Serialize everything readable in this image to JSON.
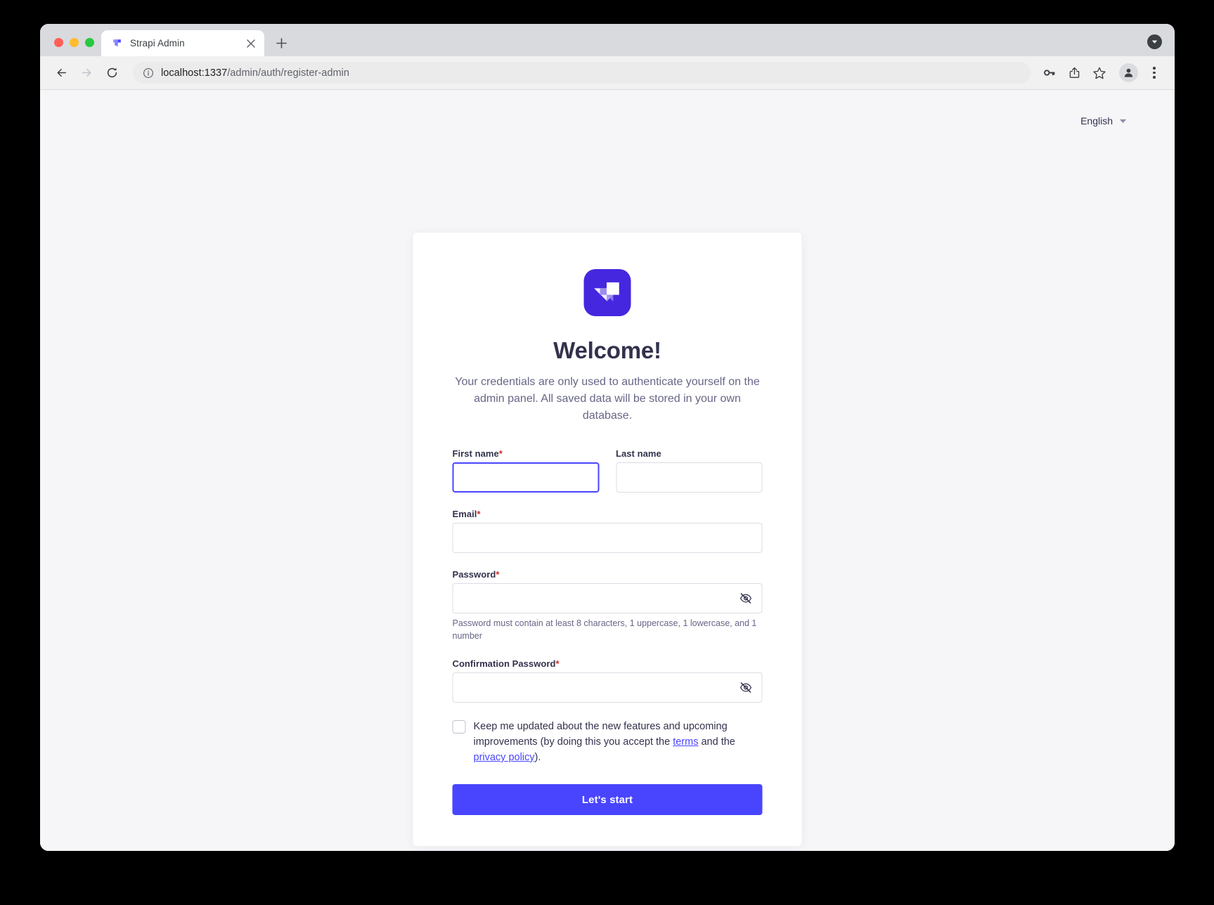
{
  "browser": {
    "tab": {
      "title": "Strapi Admin",
      "favicon_icon": "strapi-favicon",
      "close_icon": "close-icon"
    },
    "new_tab_icon": "plus-icon",
    "tab_search_icon": "chevron-down-icon",
    "toolbar": {
      "back_icon": "arrow-left-icon",
      "forward_icon": "arrow-right-icon",
      "reload_icon": "reload-icon",
      "site_info_icon": "info-circle-icon",
      "url_host": "localhost:1337",
      "url_path": "/admin/auth/register-admin",
      "url_full": "localhost:1337/admin/auth/register-admin",
      "actions": [
        {
          "name": "password-manager-icon",
          "icon": "key-icon"
        },
        {
          "name": "share-icon",
          "icon": "share-icon"
        },
        {
          "name": "bookmark-icon",
          "icon": "star-icon"
        },
        {
          "name": "profile-avatar",
          "icon": "person-icon"
        },
        {
          "name": "browser-menu",
          "icon": "three-dots-icon"
        }
      ]
    }
  },
  "page": {
    "language_switcher": {
      "label": "English",
      "caret_icon": "caret-down-icon"
    },
    "logo_icon": "strapi-logo",
    "title": "Welcome!",
    "subtitle": "Your credentials are only used to authenticate yourself on the admin panel. All saved data will be stored in your own database.",
    "form": {
      "first_name": {
        "label": "First name",
        "required_marker": "*",
        "value": "",
        "placeholder": "",
        "focused": true
      },
      "last_name": {
        "label": "Last name",
        "required_marker": "",
        "value": "",
        "placeholder": ""
      },
      "email": {
        "label": "Email",
        "required_marker": "*",
        "value": "",
        "placeholder": ""
      },
      "password": {
        "label": "Password",
        "required_marker": "*",
        "value": "",
        "placeholder": "",
        "hint": "Password must contain at least 8 characters, 1 uppercase, 1 lowercase, and 1 number",
        "toggle_icon": "eye-off-icon"
      },
      "confirmation_password": {
        "label": "Confirmation Password",
        "required_marker": "*",
        "value": "",
        "placeholder": "",
        "toggle_icon": "eye-off-icon"
      },
      "newsletter": {
        "checked": false,
        "text_part_1": "Keep me updated about the new features and upcoming improvements (by doing this you accept the ",
        "link_terms": "terms",
        "text_part_2": " and the ",
        "link_privacy": "privacy policy",
        "text_part_3": ")."
      },
      "submit_label": "Let's start"
    }
  },
  "colors": {
    "accent": "#4945ff",
    "required": "#d02b20",
    "title": "#32324d",
    "muted": "#666687",
    "page_bg": "#f6f6f9",
    "card_bg": "#ffffff",
    "logo_purple": "#4527e0"
  }
}
